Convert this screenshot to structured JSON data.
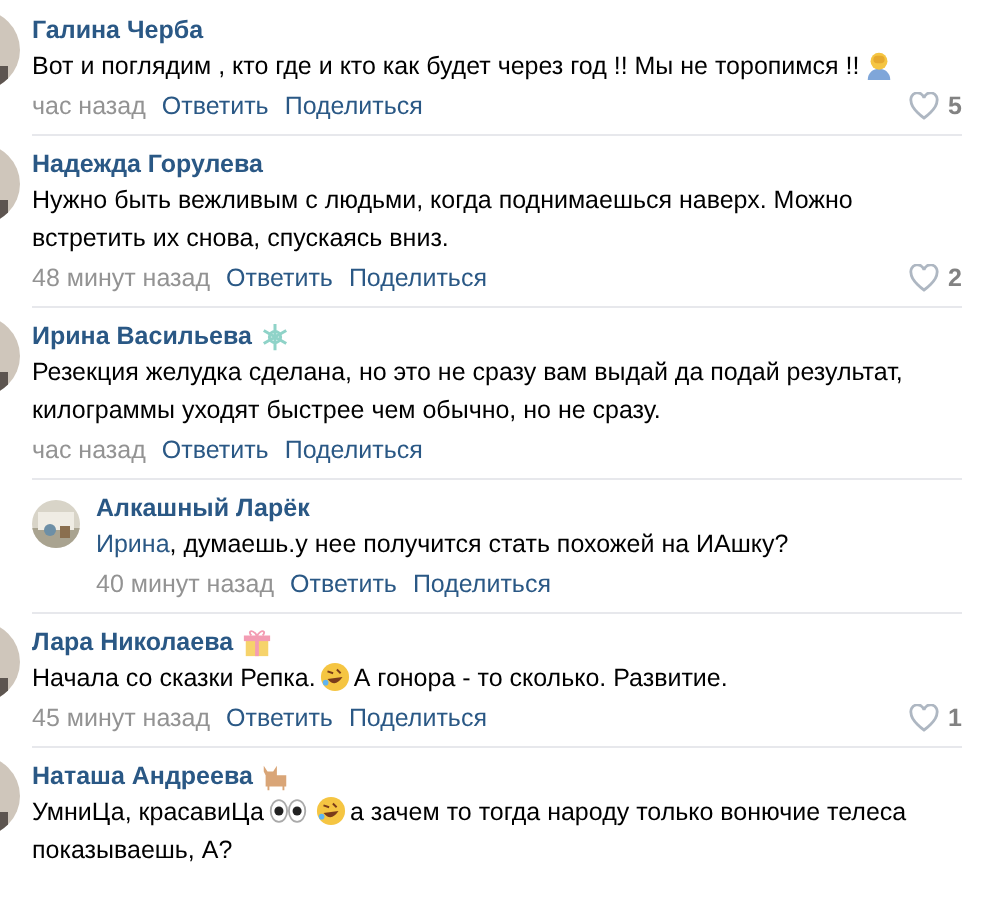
{
  "comments": [
    {
      "author": "Галина Черба",
      "reply": false,
      "parts": [
        {
          "kind": "text",
          "text": "Вот и поглядим , кто где и кто как будет через год !! Мы не торопимся !!"
        },
        {
          "kind": "facepalm"
        }
      ],
      "time": "час назад",
      "answer": "Ответить",
      "share": "Поделиться",
      "likes": "5"
    },
    {
      "author": "Надежда Горулева",
      "reply": false,
      "parts": [
        {
          "kind": "text",
          "text": "Нужно быть вежливым с людьми, когда поднимаешься наверх. Можно встретить их снова, спускаясь вниз."
        }
      ],
      "time": "48 минут назад",
      "answer": "Ответить",
      "share": "Поделиться",
      "likes": "2"
    },
    {
      "author": "Ирина Васильева",
      "badge": {
        "kind": "snowflake"
      },
      "reply": false,
      "parts": [
        {
          "kind": "text",
          "text": "Резекция желудка сделана, но это не сразу вам выдай да подай результат, килограммы уходят быстрее чем обычно, но не сразу."
        }
      ],
      "time": "час назад",
      "answer": "Ответить",
      "share": "Поделиться"
    },
    {
      "author": "Алкашный Ларёк",
      "reply": true,
      "parts": [
        {
          "kind": "mention",
          "text": "Ирина"
        },
        {
          "kind": "text",
          "text": ", думаешь.у нее получится стать похожей на ИАшку?"
        }
      ],
      "time": "40 минут назад",
      "answer": "Ответить",
      "share": "Поделиться"
    },
    {
      "author": "Лара Николаева",
      "badge": {
        "kind": "gift"
      },
      "reply": false,
      "parts": [
        {
          "kind": "text",
          "text": "Начала со сказки Репка."
        },
        {
          "kind": "laughing"
        },
        {
          "kind": "text",
          "text": "А гонора - то сколько. Развитие."
        }
      ],
      "time": "45 минут назад",
      "answer": "Ответить",
      "share": "Поделиться",
      "likes": "1"
    },
    {
      "author": "Наташа Андреева",
      "badge": {
        "kind": "cat"
      },
      "reply": false,
      "parts": [
        {
          "kind": "text",
          "text": "УмниЦа, красавиЦа"
        },
        {
          "kind": "eyes"
        },
        {
          "kind": "laughing"
        },
        {
          "kind": "text",
          "text": "а зачем то тогда народу только вонючие телеса показываешь, А?"
        }
      ]
    }
  ]
}
